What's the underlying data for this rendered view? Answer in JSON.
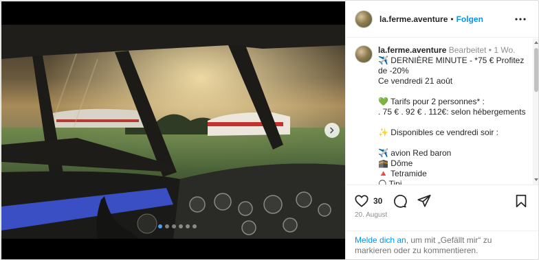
{
  "post": {
    "username": "la.ferme.aventure",
    "separator": "•",
    "follow_label": "Folgen",
    "more_icon": "more-horizontal-icon"
  },
  "carousel": {
    "slide_count": 6,
    "active_index": 0,
    "next_icon": "chevron-right-icon",
    "indicator_color": "#4a9ef5"
  },
  "caption": {
    "username": "la.ferme.aventure",
    "edited": "Bearbeitet",
    "dot": "•",
    "time": "1 Wo.",
    "lines": [
      "✈️ DERNIÈRE MINUTE - *75 € Profitez de -20%",
      "Ce vendredi 21 août",
      "",
      "💚 Tarifs pour 2 personnes* :",
      ". 75 € . 92 € . 112€: selon hébergements",
      "",
      "✨ Disponibles ce vendredi soir :",
      "",
      "✈️ avion Red baron",
      "🕋 Dôme",
      "🔺 Tetramide",
      "🌕 Tipi"
    ]
  },
  "actions": {
    "like_icon": "heart-icon",
    "like_count": "30",
    "comment_icon": "comment-icon",
    "share_icon": "share-icon",
    "save_icon": "bookmark-icon",
    "date": "20. August"
  },
  "login_prompt": {
    "link": "Melde dich an",
    "text": ", um mit „Gefällt mir“ zu markieren oder zu kommentieren."
  },
  "colors": {
    "accent": "#0095f6",
    "muted": "#8e8e8e",
    "border": "#dbdbdb"
  }
}
